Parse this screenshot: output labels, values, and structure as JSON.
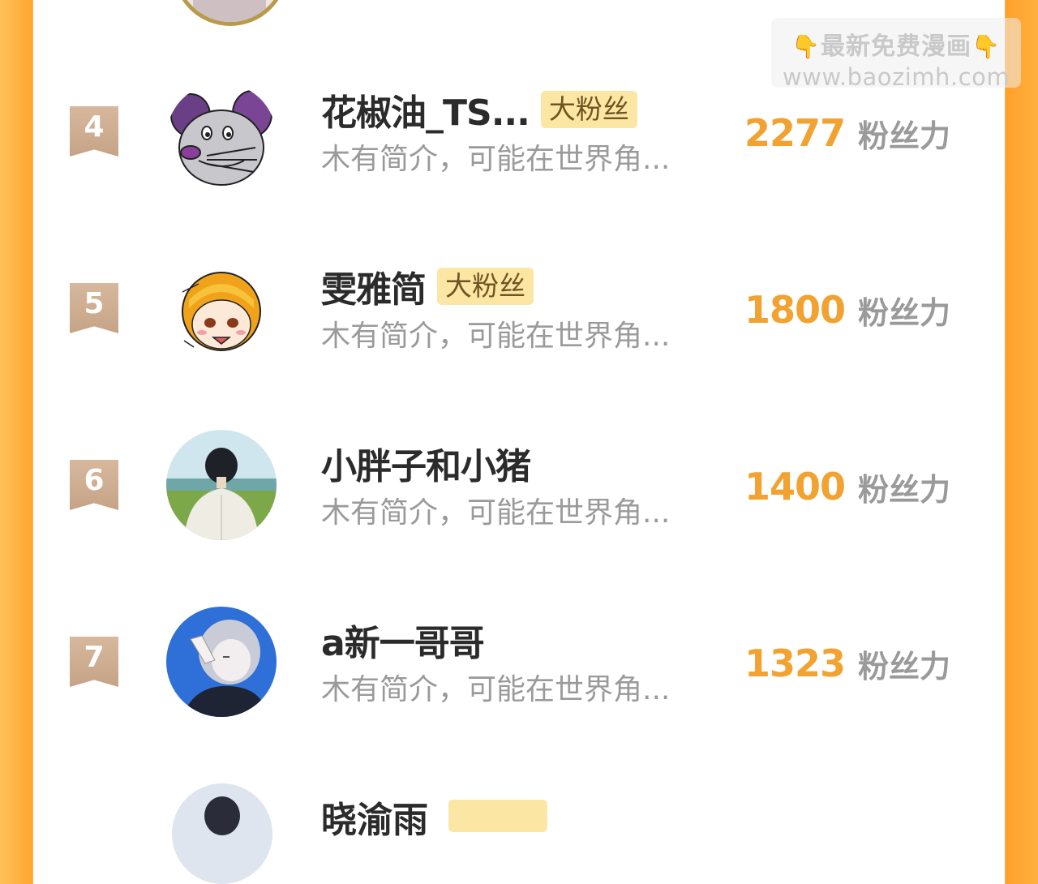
{
  "watermark": {
    "line1": "最新免费漫画",
    "line2": "www.baozimh.com",
    "hand_icon": "👇"
  },
  "rows": [
    {
      "rank": "4",
      "name": "花椒油_TS...",
      "badge": "大粉丝",
      "intro": "木有简介，可能在世界角...",
      "score": "2277",
      "unit": "粉丝力",
      "avatar_icon": "mouse-avatar"
    },
    {
      "rank": "5",
      "name": "雯雅简",
      "badge": "大粉丝",
      "intro": "木有简介，可能在世界角...",
      "score": "1800",
      "unit": "粉丝力",
      "avatar_icon": "anime-girl-avatar"
    },
    {
      "rank": "6",
      "name": "小胖子和小猪",
      "badge": "",
      "intro": "木有简介，可能在世界角...",
      "score": "1400",
      "unit": "粉丝力",
      "avatar_icon": "boy-landscape-avatar"
    },
    {
      "rank": "7",
      "name": "a新一哥哥",
      "badge": "",
      "intro": "木有简介，可能在世界角...",
      "score": "1323",
      "unit": "粉丝力",
      "avatar_icon": "anime-boy-avatar"
    }
  ],
  "partial_next": {
    "name": "晓渝雨"
  },
  "colors": {
    "accent_orange": "#f2a230",
    "badge_bg": "#fbe7a3",
    "rank_ribbon": "#c9a78a"
  }
}
